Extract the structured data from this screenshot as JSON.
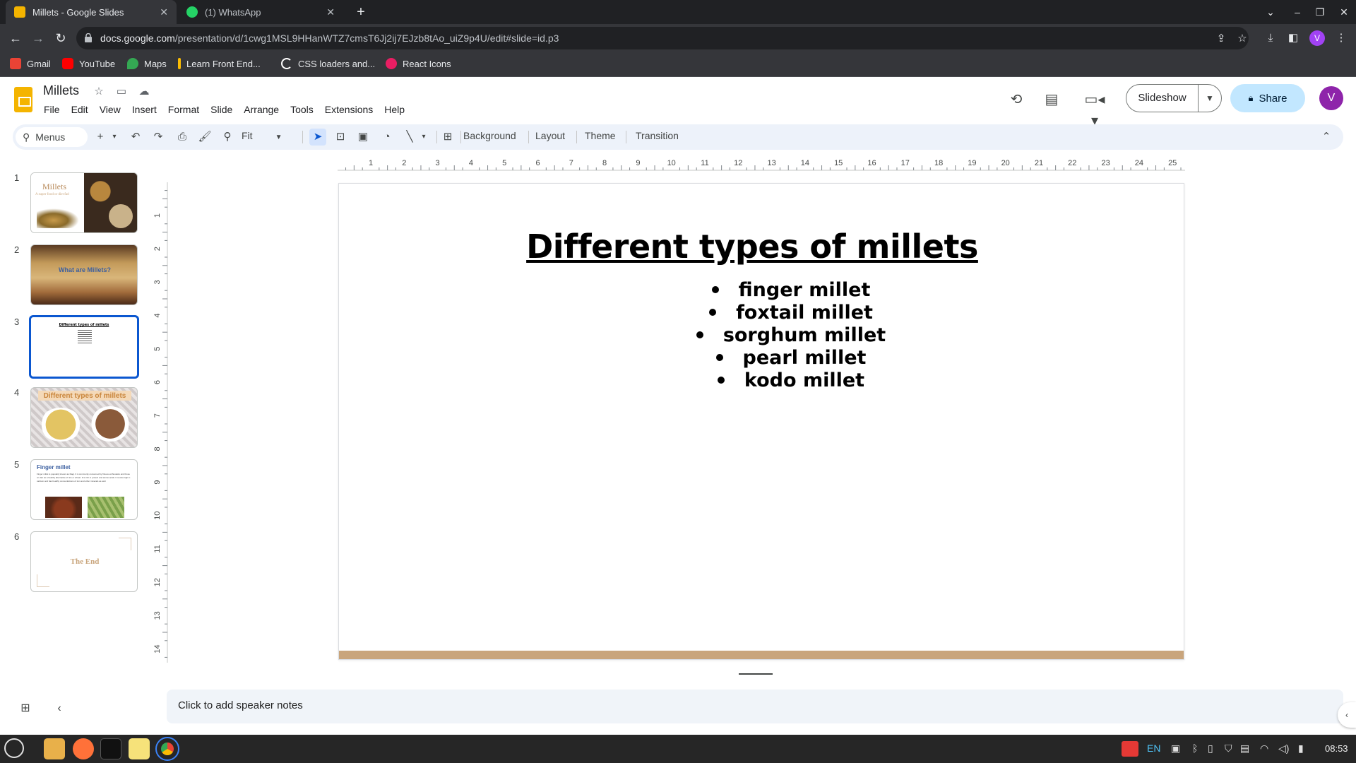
{
  "browser": {
    "tabs": [
      {
        "title": "Millets - Google Slides",
        "active": true,
        "favicon_color": "#f4b400"
      },
      {
        "title": "(1) WhatsApp",
        "active": false,
        "favicon_color": "#25d366"
      }
    ],
    "url_domain": "docs.google.com",
    "url_path": "/presentation/d/1cwg1MSL9HHanWTZ7cmsT6Jj2ij7EJzb8tAo_uiZ9p4U/edit#slide=id.p3",
    "profile_initial": "V",
    "bookmarks": [
      {
        "label": "Gmail",
        "icon": "gmail-icon",
        "color": "#ea4335"
      },
      {
        "label": "YouTube",
        "icon": "youtube-icon",
        "color": "#ff0000"
      },
      {
        "label": "Maps",
        "icon": "maps-icon",
        "color": "#34a853"
      },
      {
        "label": "Learn Front End...",
        "icon": "learn-icon",
        "color": "#fbbc04"
      },
      {
        "label": "CSS loaders and...",
        "icon": "css-loaders-icon",
        "color": "#ffffff"
      },
      {
        "label": "React Icons",
        "icon": "react-icons-icon",
        "color": "#e91e63"
      }
    ]
  },
  "app": {
    "doc_title": "Millets",
    "menu": [
      "File",
      "Edit",
      "View",
      "Insert",
      "Format",
      "Slide",
      "Arrange",
      "Tools",
      "Extensions",
      "Help"
    ],
    "slideshow_label": "Slideshow",
    "share_label": "Share",
    "user_initial": "V",
    "accent_color": "#0b57d0"
  },
  "toolbar": {
    "menus_label": "Menus",
    "zoom_label": "Fit",
    "background_label": "Background",
    "layout_label": "Layout",
    "theme_label": "Theme",
    "transition_label": "Transition"
  },
  "filmstrip": [
    {
      "num": "1",
      "title": "Millets",
      "subtitle": "A super food or diet fad"
    },
    {
      "num": "2",
      "title": "What are Millets?"
    },
    {
      "num": "3",
      "title": "Different types of millets"
    },
    {
      "num": "4",
      "title": "Different types of millets"
    },
    {
      "num": "5",
      "title": "Finger millet",
      "body": "Finger millet is popularly known as Ragi. It is commonly consumed by fitness enthusiasts and those on diet as a healthy alternative of rice or wheat. It is rich in protein and amino acids. It is also high in calcium and has healthy concentrations of iron and other minerals as well."
    },
    {
      "num": "6",
      "title": "The End"
    }
  ],
  "ruler": {
    "horizontal": [
      "1",
      "2",
      "3",
      "4",
      "5",
      "6",
      "7",
      "8",
      "9",
      "10",
      "11",
      "12",
      "13",
      "14",
      "15",
      "16",
      "17",
      "18",
      "19",
      "20",
      "21",
      "22",
      "23",
      "24",
      "25"
    ],
    "vertical": [
      "1",
      "2",
      "3",
      "4",
      "5",
      "6",
      "7",
      "8",
      "9",
      "10",
      "11",
      "12",
      "13",
      "14"
    ]
  },
  "slide": {
    "title": "Different types of millets",
    "bullets": [
      "finger millet",
      "foxtail millet",
      "sorghum millet",
      "pearl millet",
      "kodo millet"
    ],
    "bar_color": "#c9a57c"
  },
  "notes_placeholder": "Click to add speaker notes",
  "taskbar": {
    "language": "EN",
    "clock": "08:53"
  }
}
